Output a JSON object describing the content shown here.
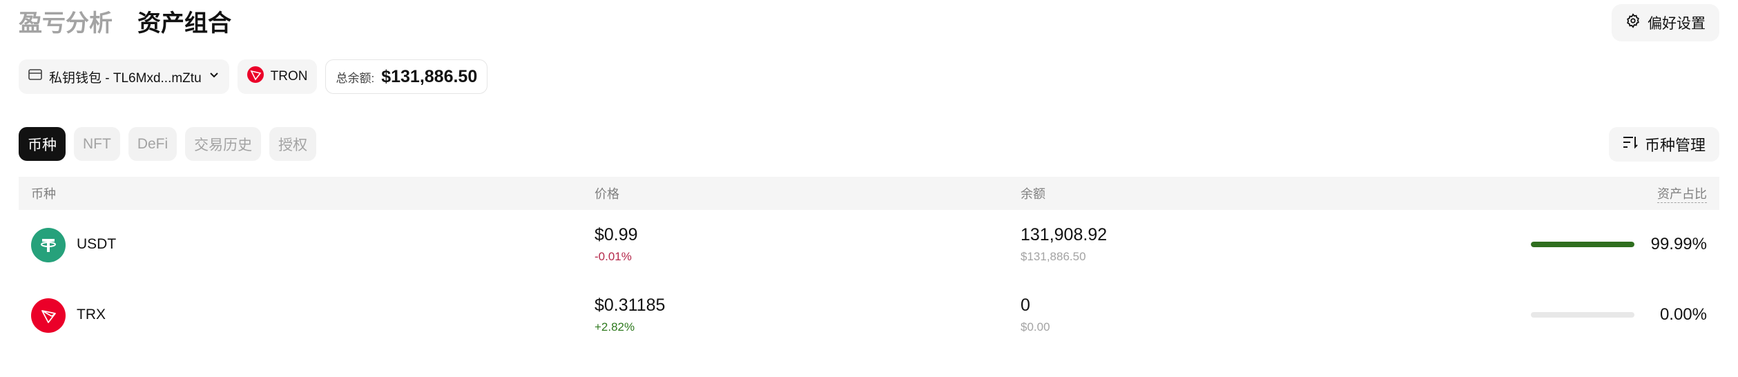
{
  "header": {
    "tabs": [
      "盈亏分析",
      "资产组合"
    ],
    "preferences_label": "偏好设置"
  },
  "wallet": {
    "selector_label": "私钥钱包 - TL6Mxd...mZtu",
    "chain_label": "TRON",
    "balance_label": "总余额:",
    "balance_value": "$131,886.50"
  },
  "tabs": [
    "币种",
    "NFT",
    "DeFi",
    "交易历史",
    "授权"
  ],
  "manage_label": "币种管理",
  "table": {
    "headers": {
      "asset": "币种",
      "price": "价格",
      "balance": "余额",
      "ratio": "资产占比"
    },
    "rows": [
      {
        "symbol": "USDT",
        "icon": "tether-icon",
        "color": "#26a17b",
        "price": "$0.99",
        "change": "-0.01%",
        "change_dir": "down",
        "balance": "131,908.92",
        "balance_usd": "$131,886.50",
        "ratio": "99.99%",
        "ratio_fraction": 0.9999
      },
      {
        "symbol": "TRX",
        "icon": "tron-icon",
        "color": "#eb0029",
        "price": "$0.31185",
        "change": "+2.82%",
        "change_dir": "up",
        "balance": "0",
        "balance_usd": "$0.00",
        "ratio": "0.00%",
        "ratio_fraction": 0.0
      }
    ]
  },
  "colors": {
    "text": "#121212",
    "muted": "#a3a3a3",
    "down": "#b5294b",
    "up": "#2f7a1f",
    "bar": "#2f6e1f"
  }
}
